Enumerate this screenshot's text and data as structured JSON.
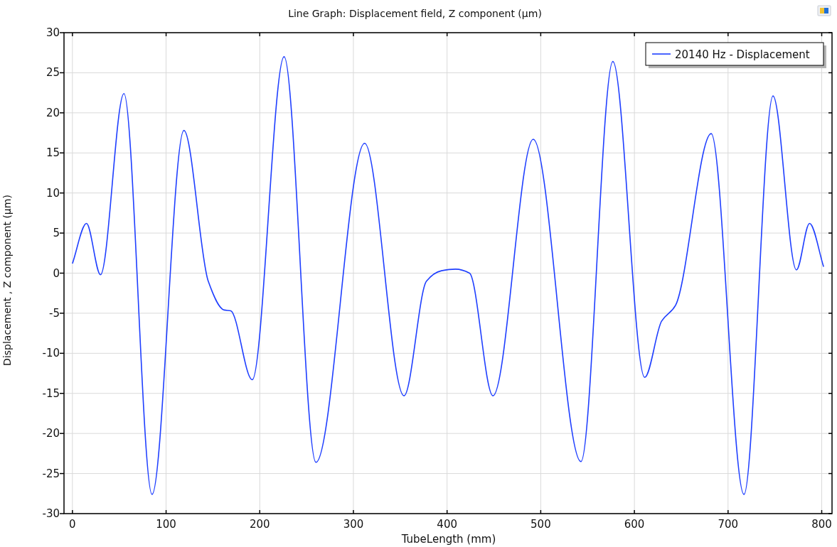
{
  "plot": {
    "chart_data": {
      "type": "line",
      "title": "Line Graph: Displacement field, Z component (µm)",
      "xlabel": "TubeLength (mm)",
      "ylabel": "Displacement , Z component (µm)",
      "x": [
        0,
        15,
        30,
        55,
        85,
        119,
        145,
        162,
        169,
        192,
        226,
        260,
        312,
        354,
        378,
        394,
        409,
        424,
        449,
        492,
        543,
        577,
        611,
        629,
        644,
        682,
        717,
        748,
        773,
        787,
        802
      ],
      "series": [
        {
          "name": "20140 Hz - Displacement",
          "color": "#1f3fff",
          "values": [
            1.2,
            6.2,
            -0.2,
            22.4,
            -27.6,
            17.8,
            -1,
            -4.6,
            -4.7,
            -13.3,
            27,
            -23.6,
            16.2,
            -15.3,
            -1,
            0.3,
            0.5,
            0,
            -15.3,
            16.7,
            -23.5,
            26.4,
            -13,
            -6,
            -4,
            17.4,
            -27.6,
            22.1,
            0.4,
            6.2,
            0.8
          ]
        }
      ],
      "grid": true,
      "xlim": [
        -9,
        811
      ],
      "ylim": [
        -30,
        30
      ],
      "xticks": [
        0,
        100,
        200,
        300,
        400,
        500,
        600,
        700,
        800
      ],
      "yticks": [
        -30,
        -25,
        -20,
        -15,
        -10,
        -5,
        0,
        5,
        10,
        15,
        20,
        25,
        30
      ]
    }
  }
}
